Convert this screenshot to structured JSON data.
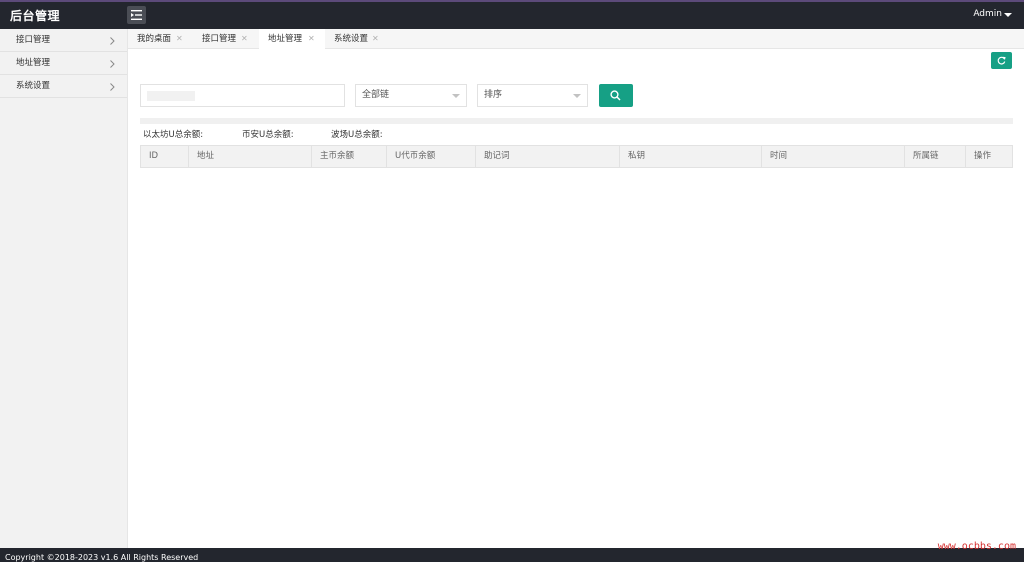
{
  "header": {
    "logo": "后台管理",
    "user": "Admin"
  },
  "sidebar": {
    "items": [
      {
        "label": "接口管理"
      },
      {
        "label": "地址管理"
      },
      {
        "label": "系统设置"
      }
    ]
  },
  "tabs": [
    {
      "label": "我的桌面",
      "active": false
    },
    {
      "label": "接口管理",
      "active": false
    },
    {
      "label": "地址管理",
      "active": true
    },
    {
      "label": "系统设置",
      "active": false
    }
  ],
  "filters": {
    "search_value": "",
    "chain_select": "全部链",
    "sort_select": "排序"
  },
  "totals": {
    "eth": "以太坊U总余额:",
    "bsc": "币安U总余额:",
    "tron": "波场U总余额:"
  },
  "table": {
    "columns": [
      "ID",
      "地址",
      "主币余额",
      "U代币余额",
      "助记词",
      "私钥",
      "时间",
      "所属链",
      "操作"
    ]
  },
  "footer": {
    "copyright": "Copyright ©2018-2023 v1.6 All Rights Reserved"
  },
  "watermark": "www.ocbbs.com",
  "colors": {
    "header_bg": "#23262e",
    "accent_green": "#16a085"
  }
}
